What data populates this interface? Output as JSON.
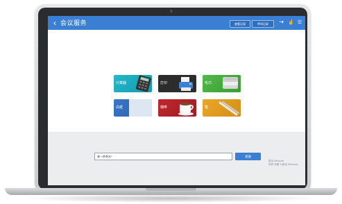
{
  "header": {
    "back_icon": "chevron-left-icon",
    "title": "会议服务",
    "buttons": [
      "查看记录",
      "呼叫记录"
    ],
    "icons": [
      "user-dropdown-icon",
      "touch-icon",
      "menu-icon"
    ]
  },
  "services": [
    {
      "label": "计算器",
      "icon": "calculator-icon"
    },
    {
      "label": "打印",
      "icon": "printer-icon"
    },
    {
      "label": "毛巾",
      "icon": "towel-icon"
    },
    {
      "label": "白纸",
      "icon": "paper-icon"
    },
    {
      "label": "咖啡",
      "icon": "coffee-cup-icon"
    },
    {
      "label": "笔",
      "icon": "pen-icon"
    }
  ],
  "footer": {
    "input_value": "来一杯茶水！",
    "send_label": "发送",
    "hint_lines": [
      "激活 Windows",
      "转到\"设置\"以激活 Windows。"
    ]
  },
  "colors": {
    "primary": "#3b7fd4",
    "tile_teal": "#1faabd",
    "tile_dark": "#2c2c2c",
    "tile_green": "#4aae40",
    "tile_blue": "#3069bb",
    "tile_red": "#b02328",
    "tile_orange": "#e09c22"
  }
}
